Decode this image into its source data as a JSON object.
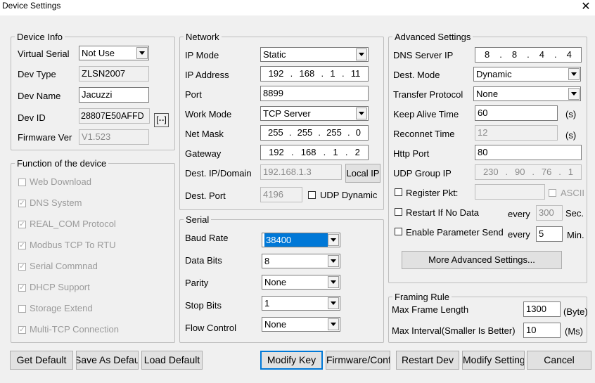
{
  "window": {
    "title": "Device Settings",
    "close_glyph": "✕"
  },
  "device_info": {
    "legend": "Device Info",
    "virtual_serial_label": "Virtual Serial",
    "virtual_serial_value": "Not Use",
    "dev_type_label": "Dev Type",
    "dev_type_value": "ZLSN2007",
    "dev_name_label": "Dev Name",
    "dev_name_value": "Jacuzzi",
    "dev_id_label": "Dev ID",
    "dev_id_value": "28807E50AFFD",
    "dev_id_button": "[--]",
    "firmware_label": "Firmware Ver",
    "firmware_value": "V1.523"
  },
  "functions": {
    "legend": "Function of the device",
    "items": [
      {
        "label": "Web Download",
        "checked": false
      },
      {
        "label": "DNS System",
        "checked": true
      },
      {
        "label": "REAL_COM Protocol",
        "checked": true
      },
      {
        "label": "Modbus TCP To RTU",
        "checked": true
      },
      {
        "label": "Serial Commnad",
        "checked": true
      },
      {
        "label": "DHCP Support",
        "checked": true
      },
      {
        "label": "Storage Extend",
        "checked": false
      },
      {
        "label": "Multi-TCP Connection",
        "checked": true
      }
    ]
  },
  "network": {
    "legend": "Network",
    "ip_mode_label": "IP Mode",
    "ip_mode_value": "Static",
    "ip_address_label": "IP Address",
    "ip_address": [
      "192",
      "168",
      "1",
      "11"
    ],
    "port_label": "Port",
    "port_value": "8899",
    "work_mode_label": "Work Mode",
    "work_mode_value": "TCP Server",
    "net_mask_label": "Net Mask",
    "net_mask": [
      "255",
      "255",
      "255",
      "0"
    ],
    "gateway_label": "Gateway",
    "gateway": [
      "192",
      "168",
      "1",
      "2"
    ],
    "dest_ip_label": "Dest. IP/Domain",
    "dest_ip_value": "192.168.1.3",
    "local_ip_button": "Local IP",
    "dest_port_label": "Dest. Port",
    "dest_port_value": "4196",
    "udp_dynamic_label": "UDP Dynamic",
    "udp_dynamic_checked": false
  },
  "serial": {
    "legend": "Serial",
    "baud_rate_label": "Baud Rate",
    "baud_rate_value": "38400",
    "data_bits_label": "Data Bits",
    "data_bits_value": "8",
    "parity_label": "Parity",
    "parity_value": "None",
    "stop_bits_label": "Stop Bits",
    "stop_bits_value": "1",
    "flow_control_label": "Flow Control",
    "flow_control_value": "None"
  },
  "advanced": {
    "legend": "Advanced Settings",
    "dns_label": "DNS Server IP",
    "dns": [
      "8",
      "8",
      "4",
      "4"
    ],
    "dest_mode_label": "Dest. Mode",
    "dest_mode_value": "Dynamic",
    "transfer_protocol_label": "Transfer Protocol",
    "transfer_protocol_value": "None",
    "keep_alive_label": "Keep Alive Time",
    "keep_alive_value": "60",
    "keep_alive_unit": "(s)",
    "reconnect_label": "Reconnet Time",
    "reconnect_value": "12",
    "reconnect_unit": "(s)",
    "http_port_label": "Http Port",
    "http_port_value": "80",
    "udp_group_label": "UDP Group IP",
    "udp_group": [
      "230",
      "90",
      "76",
      "1"
    ],
    "register_pkt_label": "Register Pkt:",
    "register_pkt_value": "",
    "ascii_label": "ASCII",
    "restart_label": "Restart If No Data",
    "restart_every": "every",
    "restart_value": "300",
    "restart_unit": "Sec.",
    "param_send_label": "Enable Parameter Send",
    "param_every": "every",
    "param_value": "5",
    "param_unit": "Min.",
    "more_button": "More Advanced Settings..."
  },
  "framing": {
    "legend": "Framing Rule",
    "max_frame_label": "Max Frame Length",
    "max_frame_value": "1300",
    "max_frame_unit": "(Byte)",
    "max_interval_label": "Max Interval(Smaller Is Better)",
    "max_interval_value": "10",
    "max_interval_unit": "(Ms)"
  },
  "buttons": {
    "get_default": "Get Default",
    "save_as_default": "Save As Default",
    "load_default": "Load Default",
    "modify_key": "Modify Key",
    "firmware_config": "Firmware/Config",
    "restart_dev": "Restart Dev",
    "modify_setting": "Modify Setting",
    "cancel": "Cancel"
  }
}
